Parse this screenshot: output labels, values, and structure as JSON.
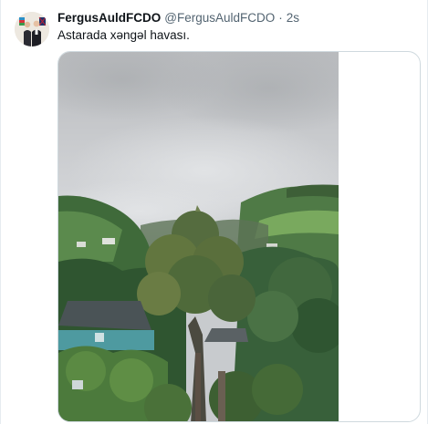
{
  "tweet": {
    "display_name": "FergusAuldFCDO",
    "handle": "@FergusAuldFCDO",
    "separator": "·",
    "time": "2s",
    "text": "Astarada xəngəl havası."
  },
  "icons": [
    "avatar-photo"
  ],
  "colors": {
    "text_primary": "#0f1419",
    "text_secondary": "#536471",
    "border": "#cfd9de"
  }
}
